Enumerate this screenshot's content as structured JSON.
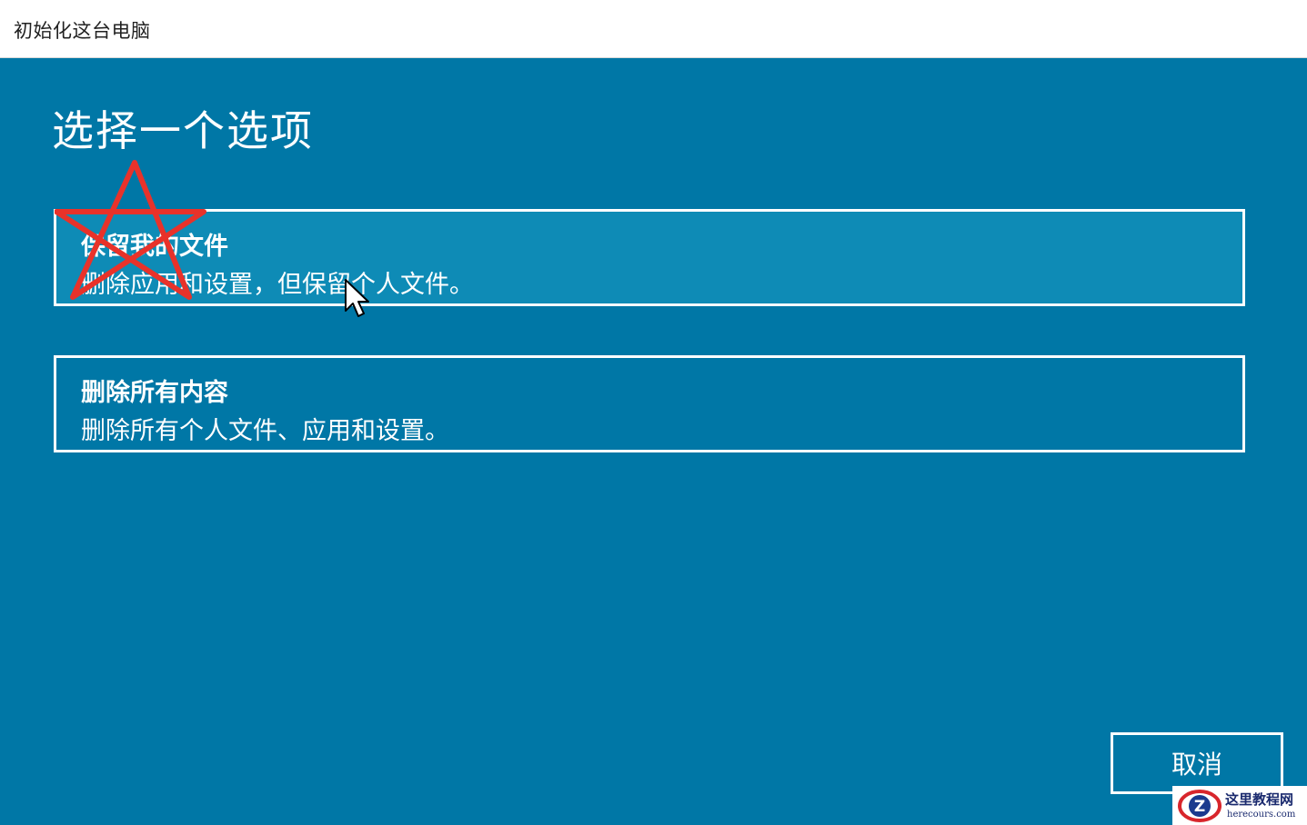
{
  "window": {
    "title": "初始化这台电脑"
  },
  "main": {
    "heading": "选择一个选项",
    "options": [
      {
        "title": "保留我的文件",
        "description": "删除应用和设置，但保留个人文件。"
      },
      {
        "title": "删除所有内容",
        "description": "删除所有个人文件、应用和设置。"
      }
    ]
  },
  "footer": {
    "cancel_label": "取消"
  },
  "overlay": {
    "annotation_shape": "red-star-icon",
    "annotation_color": "#e8322a"
  },
  "watermark": {
    "name": "这里教程网",
    "url": "herecours.com"
  },
  "colors": {
    "background": "#0077a6",
    "hover": "#0e8bb6",
    "text": "#ffffff"
  }
}
